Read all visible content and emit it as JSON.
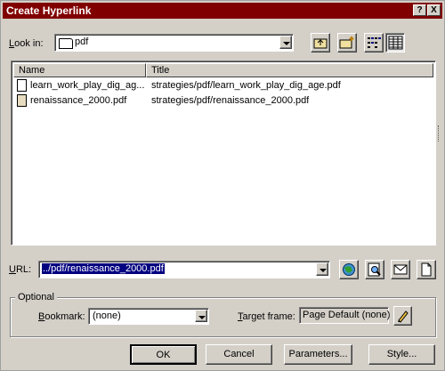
{
  "window": {
    "title": "Create Hyperlink",
    "help_label": "?",
    "close_label": "X"
  },
  "look_in": {
    "label": "Look in:",
    "value": "pdf"
  },
  "toolbar_icons": [
    "up-folder-icon",
    "new-folder-icon",
    "list-view-icon",
    "details-view-icon"
  ],
  "file_list": {
    "columns": [
      "Name",
      "Title"
    ],
    "rows": [
      {
        "name": "learn_work_play_dig_ag...",
        "title": "strategies/pdf/learn_work_play_dig_age.pdf"
      },
      {
        "name": "renaissance_2000.pdf",
        "title": "strategies/pdf/renaissance_2000.pdf"
      }
    ]
  },
  "url": {
    "label": "URL:",
    "value": "../pdf/renaissance_2000.pdf"
  },
  "url_icons": [
    "browse-web-icon",
    "browse-file-icon",
    "email-icon",
    "new-page-icon"
  ],
  "optional": {
    "group_label": "Optional",
    "bookmark_label": "Bookmark:",
    "bookmark_value": "(none)",
    "target_label": "Target frame:",
    "target_value": "Page Default (none)"
  },
  "buttons": {
    "ok": "OK",
    "cancel": "Cancel",
    "parameters": "Parameters...",
    "style": "Style..."
  }
}
